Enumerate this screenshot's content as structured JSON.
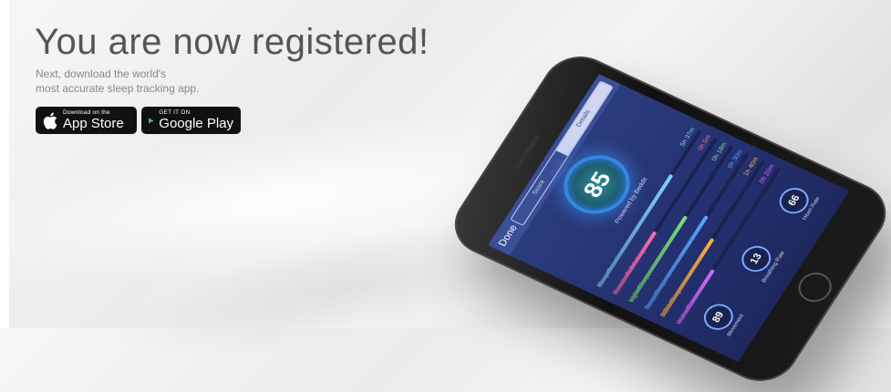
{
  "header": {
    "title": "You are now registered!",
    "subtitle_line1": "Next, download the world's",
    "subtitle_line2": "most accurate sleep tracking app."
  },
  "badges": {
    "app_store": {
      "small": "Download on the",
      "big": "App Store"
    },
    "google_play": {
      "small": "GET IT ON",
      "big": "Google Play"
    }
  },
  "phone_app": {
    "done_label": "Done",
    "tabs": [
      "Score",
      "Details"
    ],
    "score": "85",
    "powered_by": "Powered by Beddit",
    "metrics": [
      {
        "label": "Sleep Duration",
        "value": "5h 37m",
        "color": "#7fd3ff",
        "fill": 0.72
      },
      {
        "label": "Time to Fall Asleep",
        "value": "0h 5m",
        "color": "#ff6fb0",
        "fill": 0.4
      },
      {
        "label": "Light Sleep",
        "value": "0h 18m",
        "color": "#7be37b",
        "fill": 0.55
      },
      {
        "label": "Deep Sleep",
        "value": "0h 30m",
        "color": "#5aa7ff",
        "fill": 0.6
      },
      {
        "label": "REM Sleep",
        "value": "1h 40m",
        "color": "#ffb347",
        "fill": 0.5
      },
      {
        "label": "Wake Time",
        "value": "0h 20m",
        "color": "#d86bff",
        "fill": 0.35
      }
    ],
    "circles": [
      {
        "value": "89",
        "caption": "Movement"
      },
      {
        "value": "13",
        "caption": "Breathing Rate"
      },
      {
        "value": "66",
        "caption": "Heart Rate"
      }
    ]
  }
}
